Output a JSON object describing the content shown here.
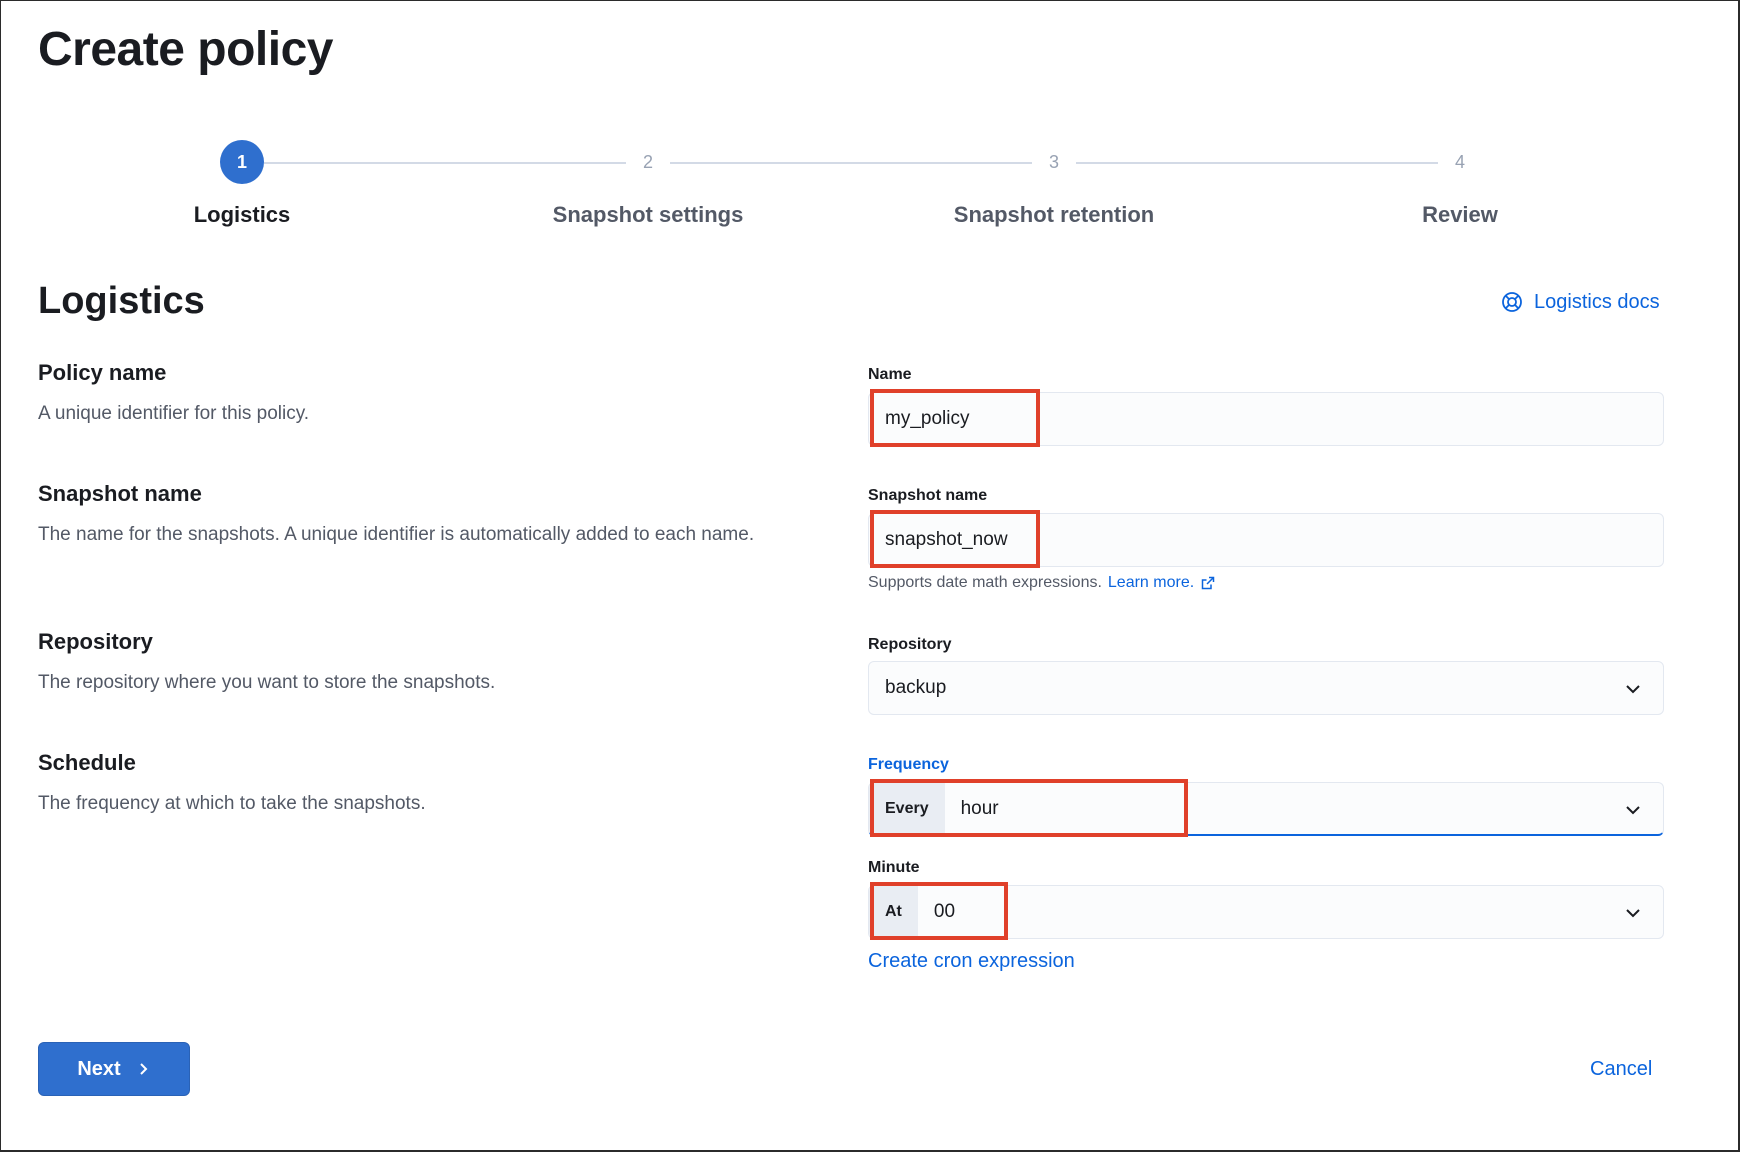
{
  "page": {
    "title": "Create policy"
  },
  "stepper": {
    "steps": [
      {
        "number": "1",
        "label": "Logistics",
        "active": true
      },
      {
        "number": "2",
        "label": "Snapshot settings",
        "active": false
      },
      {
        "number": "3",
        "label": "Snapshot retention",
        "active": false
      },
      {
        "number": "4",
        "label": "Review",
        "active": false
      }
    ]
  },
  "section": {
    "title": "Logistics",
    "docs_link": "Logistics docs",
    "docs_icon": "lifebuoy-icon"
  },
  "rows": {
    "policy_name": {
      "title": "Policy name",
      "description": "A unique identifier for this policy.",
      "label": "Name",
      "value": "my_policy"
    },
    "snapshot_name": {
      "title": "Snapshot name",
      "description": "The name for the snapshots. A unique identifier is automatically added to each name.",
      "label": "Snapshot name",
      "value": "snapshot_now",
      "help_text": "Supports date math expressions.",
      "help_link": "Learn more."
    },
    "repository": {
      "title": "Repository",
      "description": "The repository where you want to store the snapshots.",
      "label": "Repository",
      "value": "backup"
    },
    "schedule": {
      "title": "Schedule",
      "description": "The frequency at which to take the snapshots.",
      "frequency_label": "Frequency",
      "frequency_prepend": "Every",
      "frequency_value": "hour",
      "minute_label": "Minute",
      "minute_prepend": "At",
      "minute_value": "00",
      "cron_link": "Create cron expression"
    }
  },
  "footer": {
    "next_label": "Next",
    "cancel_label": "Cancel"
  },
  "colors": {
    "primary": "#2f6fce",
    "link": "#0b64dd",
    "highlight": "#e0402a"
  }
}
